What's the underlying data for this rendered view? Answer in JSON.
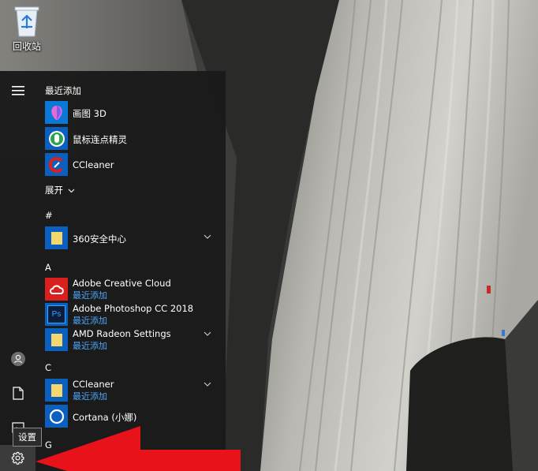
{
  "desktop": {
    "recycle_bin_label": "回收站"
  },
  "start_menu": {
    "recent_title": "最近添加",
    "recent_apps": [
      {
        "name": "画图 3D",
        "icon": "paint3d-icon"
      },
      {
        "name": "鼠标连点精灵",
        "icon": "mouse-clicker-icon"
      },
      {
        "name": "CCleaner",
        "icon": "ccleaner-icon"
      }
    ],
    "expand_label": "展开",
    "sections": [
      {
        "letter": "#",
        "apps": [
          {
            "name": "360安全中心",
            "sub": "",
            "icon": "folder-icon",
            "expandable": true
          }
        ]
      },
      {
        "letter": "A",
        "apps": [
          {
            "name": "Adobe Creative Cloud",
            "sub": "最近添加",
            "icon": "creative-cloud-icon",
            "expandable": false
          },
          {
            "name": "Adobe Photoshop CC 2018",
            "sub": "最近添加",
            "icon": "photoshop-icon",
            "expandable": false
          },
          {
            "name": "AMD Radeon Settings",
            "sub": "最近添加",
            "icon": "folder-icon",
            "expandable": true
          }
        ]
      },
      {
        "letter": "C",
        "apps": [
          {
            "name": "CCleaner",
            "sub": "最近添加",
            "icon": "folder-icon",
            "expandable": true
          },
          {
            "name": "Cortana (小娜)",
            "sub": "",
            "icon": "cortana-icon",
            "expandable": false
          }
        ]
      },
      {
        "letter": "G",
        "apps": []
      }
    ],
    "rail_icons": [
      "hamburger-icon",
      "user-icon",
      "document-icon",
      "pictures-icon",
      "gear-icon"
    ],
    "tooltip": "设置",
    "ps_letters": "Ps"
  },
  "colors": {
    "menu_bg": "#1a1a1a",
    "accent": "#0a78d7",
    "sub_text": "#4aa7ff",
    "annotation_arrow": "#e8121a"
  }
}
